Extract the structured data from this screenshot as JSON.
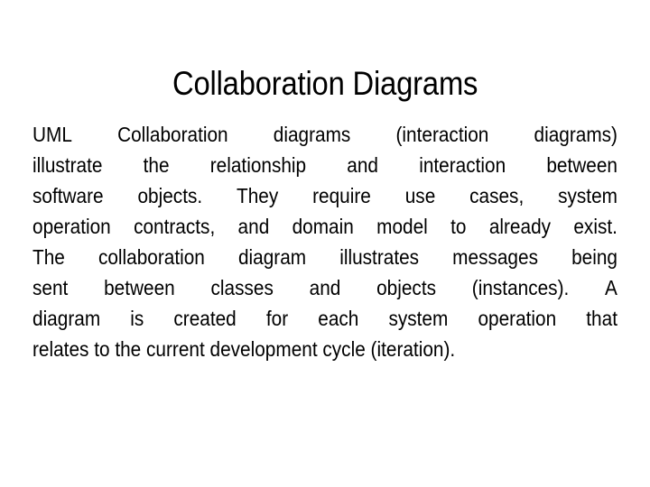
{
  "slide": {
    "title": "Collaboration Diagrams",
    "background_color": "#ffffff",
    "text_color": "#000000",
    "body_paragraph": "UML Collaboration diagrams (interaction diagrams) illustrate the relationship and interaction between software objects. They require use cases, system operation contracts, and domain model to already exist. The collaboration diagram illustrates messages being sent between classes and objects (instances). A diagram is created for each system operation that relates to the current development cycle (iteration).",
    "body_lines": [
      {
        "index": 1,
        "justified": true,
        "words": [
          "UML",
          "Collaboration",
          "diagrams",
          "(interaction",
          "diagrams)"
        ]
      },
      {
        "index": 2,
        "justified": true,
        "words": [
          "illustrate",
          "the",
          "relationship",
          "and",
          "interaction",
          "between"
        ]
      },
      {
        "index": 3,
        "justified": true,
        "words": [
          "software",
          "objects.",
          "They",
          "require",
          "use",
          "cases,",
          "system"
        ]
      },
      {
        "index": 4,
        "justified": true,
        "words": [
          "operation",
          "contracts,",
          "and",
          "domain",
          "model",
          "to",
          "already",
          "exist."
        ]
      },
      {
        "index": 5,
        "justified": true,
        "words": [
          "The",
          "collaboration",
          "diagram",
          "illustrates",
          "messages",
          "being"
        ]
      },
      {
        "index": 6,
        "justified": true,
        "words": [
          "sent",
          "between",
          "classes",
          "and",
          "objects",
          "(instances).",
          "A"
        ]
      },
      {
        "index": 7,
        "justified": true,
        "words": [
          "diagram",
          "is",
          "created",
          "for",
          "each",
          "system",
          "operation",
          "that"
        ]
      },
      {
        "index": 8,
        "justified": false,
        "words": [
          "relates to the current development cycle (iteration)."
        ]
      }
    ]
  }
}
